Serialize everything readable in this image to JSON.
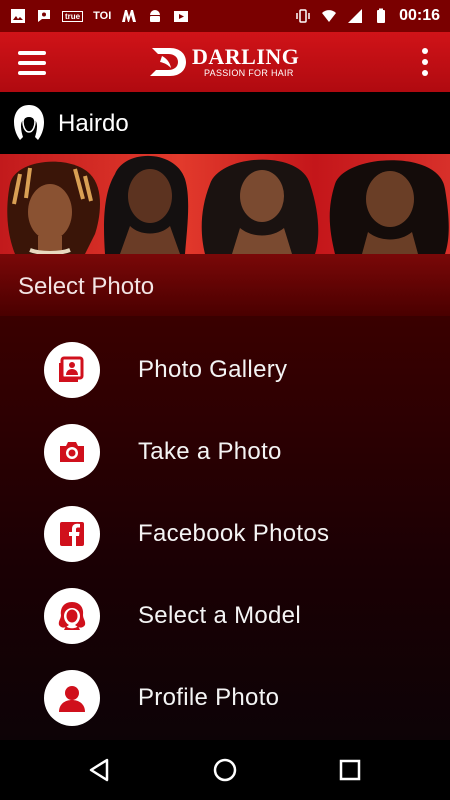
{
  "status_bar": {
    "carrier_text": "TOI",
    "true_badge": "true",
    "time": "00:16"
  },
  "toolbar": {
    "brand_name": "DARLING",
    "brand_tagline": "PASSION FOR HAIR"
  },
  "page": {
    "title": "Hairdo"
  },
  "section": {
    "title": "Select Photo"
  },
  "menu": {
    "items": [
      {
        "label": "Photo Gallery",
        "icon": "gallery-icon"
      },
      {
        "label": "Take a Photo",
        "icon": "camera-icon"
      },
      {
        "label": "Facebook Photos",
        "icon": "facebook-icon"
      },
      {
        "label": "Select a Model",
        "icon": "model-icon"
      },
      {
        "label": "Profile Photo",
        "icon": "profile-icon"
      }
    ]
  },
  "colors": {
    "brand_red": "#c8101a",
    "icon_red": "#d0101c",
    "status_bar": "#7a0000"
  }
}
